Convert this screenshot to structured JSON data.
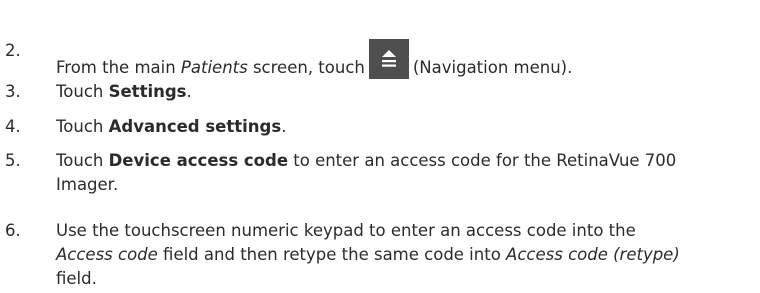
{
  "steps": [
    {
      "number": "2.",
      "prefix": "From the main ",
      "screen_name": "Patients",
      "middle": " screen, touch",
      "icon": "navigation-menu-icon",
      "suffix": "(Navigation menu)."
    },
    {
      "number": "3.",
      "prefix": "Touch ",
      "bold": "Settings",
      "suffix": "."
    },
    {
      "number": "4.",
      "prefix": "Touch ",
      "bold": "Advanced settings",
      "suffix": "."
    },
    {
      "number": "5.",
      "prefix": "Touch ",
      "bold": "Device access code",
      "suffix": " to enter an access code for the RetinaVue 700",
      "line2": "Imager."
    },
    {
      "number": "6.",
      "line1": "Use the touchscreen numeric keypad to enter an access code into the",
      "field1": "Access code",
      "line2_mid": " field and then retype the same code into ",
      "field2": "Access code (retype)",
      "line3": "field."
    }
  ]
}
